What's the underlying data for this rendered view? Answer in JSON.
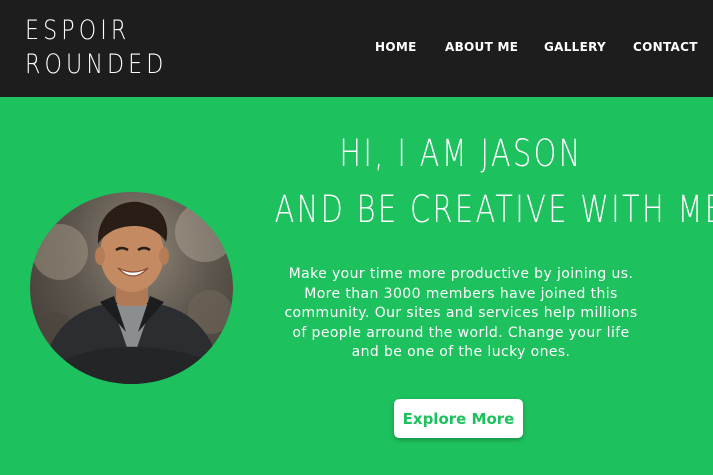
{
  "brand": {
    "line1": "ESPOIR",
    "line2": "ROUNDED"
  },
  "nav": {
    "items": [
      "HOME",
      "ABOUT ME",
      "GALLERY",
      "CONTACT"
    ]
  },
  "hero": {
    "title_line1": "HI, I AM JASON",
    "title_line2": "AND BE CREATIVE WITH ME",
    "lines": [
      "Make your time more productive by joining us.",
      "More than 3000 members have joined this",
      "community. Our sites and services help millions",
      "of people arround the world. Change your life",
      "and be one of the lucky ones."
    ],
    "cta_label": "Explore More"
  },
  "colors": {
    "header_bg": "#1d1d1d",
    "accent": "#1dc15d",
    "text": "#ffffff"
  }
}
